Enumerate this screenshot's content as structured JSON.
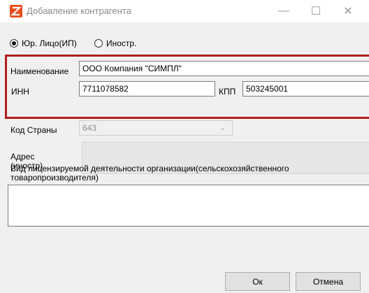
{
  "window": {
    "title": "Добавление контрагента",
    "controls": {
      "minimize": "—",
      "maximize": "☐",
      "close": "✕"
    },
    "icon": "app-logo-icon",
    "accent": "#e84d1c"
  },
  "entity_type": {
    "options": [
      {
        "label": "Юр. Лицо(ИП)",
        "selected": true
      },
      {
        "label": "Иностр.",
        "selected": false
      }
    ]
  },
  "form": {
    "name_label": "Наименование",
    "name_value": "ООО Компания \"СИМПЛ\"",
    "inn_label": "ИНН",
    "inn_value": "7711078582",
    "kpp_label": "КПП",
    "kpp_value": "503245001",
    "country_label": "Код Страны",
    "country_value": "643",
    "address_label": "Адрес\n(иностр)",
    "address_value": "",
    "license_label": "Вид лицензируемой деятельности организации(сельскохозяйственного товаропроизводителя)",
    "license_value": "",
    "highlight_color": "#b01e1e"
  },
  "buttons": {
    "ok": "Ок",
    "cancel": "Отмена"
  }
}
